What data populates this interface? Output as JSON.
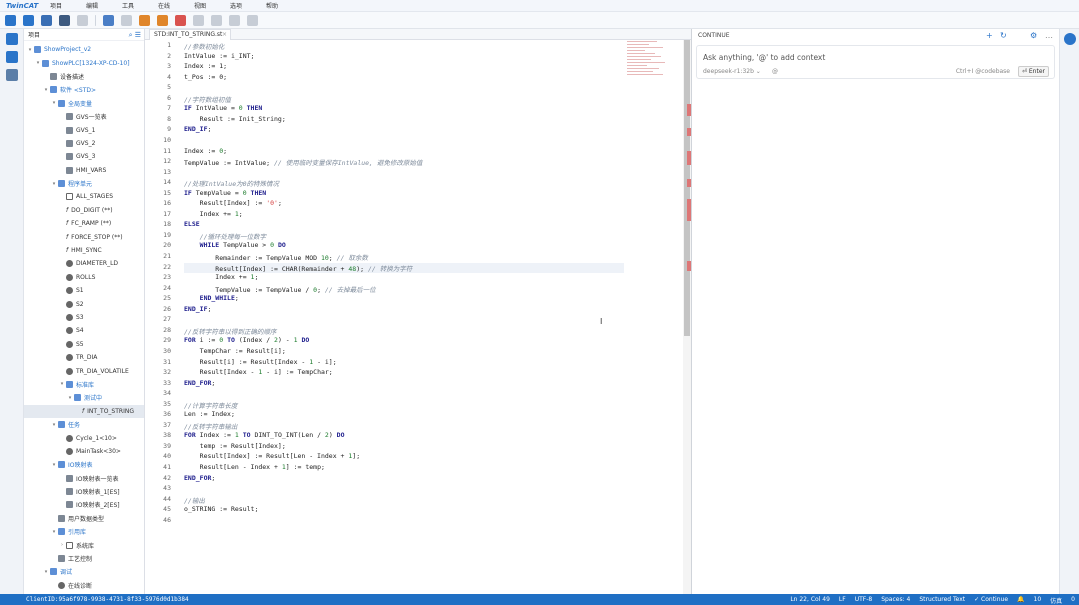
{
  "menubar": {
    "logo": "TwinCAT",
    "items": [
      "项目",
      "编辑",
      "工具",
      "在线",
      "视图",
      "选项",
      "帮助"
    ]
  },
  "explorer": {
    "title": "项目",
    "items": [
      {
        "label": "ShowProject_v2",
        "level": 0,
        "kind": "folder",
        "twisty": "▾",
        "blue": true
      },
      {
        "label": "ShowPLC[1324-XP-CD-10]",
        "level": 1,
        "kind": "folder",
        "twisty": "▾",
        "blue": true
      },
      {
        "label": "设备描述",
        "level": 2,
        "kind": "grid",
        "twisty": ""
      },
      {
        "label": "软件 <STD>",
        "level": 2,
        "kind": "folder",
        "twisty": "▾",
        "blue": true
      },
      {
        "label": "全局变量",
        "level": 3,
        "kind": "folder",
        "twisty": "▾",
        "blue": true
      },
      {
        "label": "GVS一览表",
        "level": 4,
        "kind": "grid",
        "twisty": ""
      },
      {
        "label": "GVS_1",
        "level": 4,
        "kind": "grid",
        "twisty": ""
      },
      {
        "label": "GVS_2",
        "level": 4,
        "kind": "grid",
        "twisty": ""
      },
      {
        "label": "GVS_3",
        "level": 4,
        "kind": "grid",
        "twisty": ""
      },
      {
        "label": "HMI_VARS",
        "level": 4,
        "kind": "grid",
        "twisty": ""
      },
      {
        "label": "程序单元",
        "level": 3,
        "kind": "folder",
        "twisty": "▾",
        "blue": true
      },
      {
        "label": "ALL_STAGES",
        "level": 4,
        "kind": "code",
        "twisty": ""
      },
      {
        "label": "DO_DIGIT (**)",
        "level": 4,
        "kind": "fx",
        "twisty": ""
      },
      {
        "label": "FC_RAMP (**)",
        "level": 4,
        "kind": "fx",
        "twisty": ""
      },
      {
        "label": "FORCE_STOP (**)",
        "level": 4,
        "kind": "fx",
        "twisty": ""
      },
      {
        "label": "HMI_SYNC",
        "level": 4,
        "kind": "fx",
        "twisty": ""
      },
      {
        "label": "DIAMETER_LD",
        "level": 4,
        "kind": "gear",
        "twisty": ""
      },
      {
        "label": "ROLLS",
        "level": 4,
        "kind": "gear",
        "twisty": ""
      },
      {
        "label": "S1",
        "level": 4,
        "kind": "gear",
        "twisty": ""
      },
      {
        "label": "S2",
        "level": 4,
        "kind": "gear",
        "twisty": ""
      },
      {
        "label": "S3",
        "level": 4,
        "kind": "gear",
        "twisty": ""
      },
      {
        "label": "S4",
        "level": 4,
        "kind": "gear",
        "twisty": ""
      },
      {
        "label": "S5",
        "level": 4,
        "kind": "gear",
        "twisty": ""
      },
      {
        "label": "TR_DIA",
        "level": 4,
        "kind": "gear",
        "twisty": ""
      },
      {
        "label": "TR_DIA_VOLATILE",
        "level": 4,
        "kind": "gear",
        "twisty": ""
      },
      {
        "label": "标准库",
        "level": 4,
        "kind": "folder",
        "twisty": "▾",
        "blue": true
      },
      {
        "label": "测试中",
        "level": 5,
        "kind": "folder",
        "twisty": "▾",
        "blue": true
      },
      {
        "label": "INT_TO_STRING",
        "level": 6,
        "kind": "fx",
        "twisty": "",
        "selected": true
      },
      {
        "label": "任务",
        "level": 3,
        "kind": "folder",
        "twisty": "▾",
        "blue": true
      },
      {
        "label": "Cycle_1<10>",
        "level": 4,
        "kind": "gear",
        "twisty": ""
      },
      {
        "label": "MainTask<30>",
        "level": 4,
        "kind": "gear",
        "twisty": ""
      },
      {
        "label": "IO映射表",
        "level": 3,
        "kind": "folder",
        "twisty": "▾",
        "blue": true
      },
      {
        "label": "IO映射表一览表",
        "level": 4,
        "kind": "grid",
        "twisty": ""
      },
      {
        "label": "IO映射表_1[ES]",
        "level": 4,
        "kind": "grid",
        "twisty": ""
      },
      {
        "label": "IO映射表_2[ES]",
        "level": 4,
        "kind": "grid",
        "twisty": ""
      },
      {
        "label": "用户数据类型",
        "level": 3,
        "kind": "grid",
        "twisty": ""
      },
      {
        "label": "引用库",
        "level": 3,
        "kind": "folder",
        "twisty": "▾",
        "blue": true
      },
      {
        "label": "系统库",
        "level": 4,
        "kind": "file",
        "twisty": "›"
      },
      {
        "label": "工艺控制",
        "level": 3,
        "kind": "grid",
        "twisty": ""
      },
      {
        "label": "调试",
        "level": 2,
        "kind": "folder",
        "twisty": "▾",
        "blue": true
      },
      {
        "label": "在线诊断",
        "level": 3,
        "kind": "gear",
        "twisty": ""
      }
    ]
  },
  "editor": {
    "tab_label": "STD:INT_TO_STRING.st",
    "lines": [
      {
        "n": "1",
        "html": "<span class='cm'>//参数初始化</span>"
      },
      {
        "n": "2",
        "html": "IntValue := i_INT;"
      },
      {
        "n": "3",
        "html": "Index := 1;"
      },
      {
        "n": "4",
        "html": "t_Pos := 0;"
      },
      {
        "n": "5",
        "html": ""
      },
      {
        "n": "6",
        "html": "<span class='cm'>//字符数组初值</span>"
      },
      {
        "n": "7",
        "html": "<span class='kw'>IF</span> IntValue = <span class='num'>0</span> <span class='kw'>THEN</span>"
      },
      {
        "n": "8",
        "html": "    Result := Init_String;"
      },
      {
        "n": "9",
        "html": "<span class='kw'>END_IF</span>;"
      },
      {
        "n": "10",
        "html": ""
      },
      {
        "n": "11",
        "html": "Index := <span class='num'>0</span>;"
      },
      {
        "n": "12",
        "html": "TempValue := IntValue; <span class='cm'>// 使用临时变量保存IntValue, 避免修改原始值</span>"
      },
      {
        "n": "13",
        "html": ""
      },
      {
        "n": "14",
        "html": "<span class='cm'>//处理IntValue为0的特殊情况</span>"
      },
      {
        "n": "15",
        "html": "<span class='kw'>IF</span> TempValue = <span class='num'>0</span> <span class='kw'>THEN</span>"
      },
      {
        "n": "16",
        "html": "    Result[Index] := <span class='str'>'0'</span>;"
      },
      {
        "n": "17",
        "html": "    Index += <span class='num'>1</span>;"
      },
      {
        "n": "18",
        "html": "<span class='kw'>ELSE</span>"
      },
      {
        "n": "19",
        "html": "    <span class='cm'>//循环处理每一位数字</span>"
      },
      {
        "n": "20",
        "html": "    <span class='kw'>WHILE</span> TempValue &gt; <span class='num'>0</span> <span class='kw'>DO</span>"
      },
      {
        "n": "21",
        "html": "        Remainder := TempValue MOD <span class='num'>10</span>; <span class='cm'>// 取余数</span>"
      },
      {
        "n": "22",
        "html": "        Result[Index] := CHAR(Remainder + <span class='num'>48</span>); <span class='cm'>// 转换为字符</span>"
      },
      {
        "n": "23",
        "html": "        Index += <span class='num'>1</span>;"
      },
      {
        "n": "24",
        "html": "        TempValue := TempValue / <span class='num'>0</span>; <span class='cm'>// 去掉最后一位</span>"
      },
      {
        "n": "25",
        "html": "    <span class='kw'>END_WHILE</span>;"
      },
      {
        "n": "26",
        "html": "<span class='kw'>END_IF</span>;"
      },
      {
        "n": "27",
        "html": ""
      },
      {
        "n": "28",
        "html": "<span class='cm'>//反转字符串以得到正确的顺序</span>"
      },
      {
        "n": "29",
        "html": "<span class='kw'>FOR</span> i := <span class='num'>0</span> <span class='kw'>TO</span> (Index / <span class='num'>2</span>) - <span class='num'>1</span> <span class='kw'>DO</span>"
      },
      {
        "n": "30",
        "html": "    TempChar := Result[i];"
      },
      {
        "n": "31",
        "html": "    Result[i] := Result[Index - <span class='num'>1</span> - i];"
      },
      {
        "n": "32",
        "html": "    Result[Index - <span class='num'>1</span> - i] := TempChar;"
      },
      {
        "n": "33",
        "html": "<span class='kw'>END_FOR</span>;"
      },
      {
        "n": "34",
        "html": ""
      },
      {
        "n": "35",
        "html": "<span class='cm'>//计算字符串长度</span>"
      },
      {
        "n": "36",
        "html": "Len := Index;"
      },
      {
        "n": "37",
        "html": "<span class='cm'>//反转字符串输出</span>"
      },
      {
        "n": "38",
        "html": "<span class='kw'>FOR</span> Index := <span class='num'>1</span> <span class='kw'>TO</span> DINT_TO_INT(Len / <span class='num'>2</span>) <span class='kw'>DO</span>"
      },
      {
        "n": "39",
        "html": "    temp := Result[Index];"
      },
      {
        "n": "40",
        "html": "    Result[Index] := Result[Len - Index + <span class='num'>1</span>];"
      },
      {
        "n": "41",
        "html": "    Result[Len - Index + <span class='num'>1</span>] := temp;"
      },
      {
        "n": "42",
        "html": "<span class='kw'>END_FOR</span>;"
      },
      {
        "n": "43",
        "html": ""
      },
      {
        "n": "44",
        "html": "<span class='cm'>//输出</span>"
      },
      {
        "n": "45",
        "html": "o_STRING := Result;"
      },
      {
        "n": "46",
        "html": ""
      }
    ]
  },
  "panel": {
    "title": "CONTINUE",
    "chat_placeholder": "Ask anything, '@' to add context",
    "model": "deepseek-r1:32b ⌄",
    "at": "@",
    "hint": "Ctrl+I @codebase",
    "enter": "⏎ Enter"
  },
  "status": {
    "client_id": "ClientID:95a6f978-9938-4731-8f33-5976d0d1b384",
    "right": [
      "Ln 22, Col 49",
      "LF",
      "UTF-8",
      "Spaces: 4",
      "Structured Text",
      "✓ Continue",
      "🔔",
      "10",
      "仿真",
      "0"
    ]
  },
  "colors": {
    "accent": "#1f6fc4",
    "status_bg": "#1f6fc4",
    "error_mark": "#d77777"
  }
}
